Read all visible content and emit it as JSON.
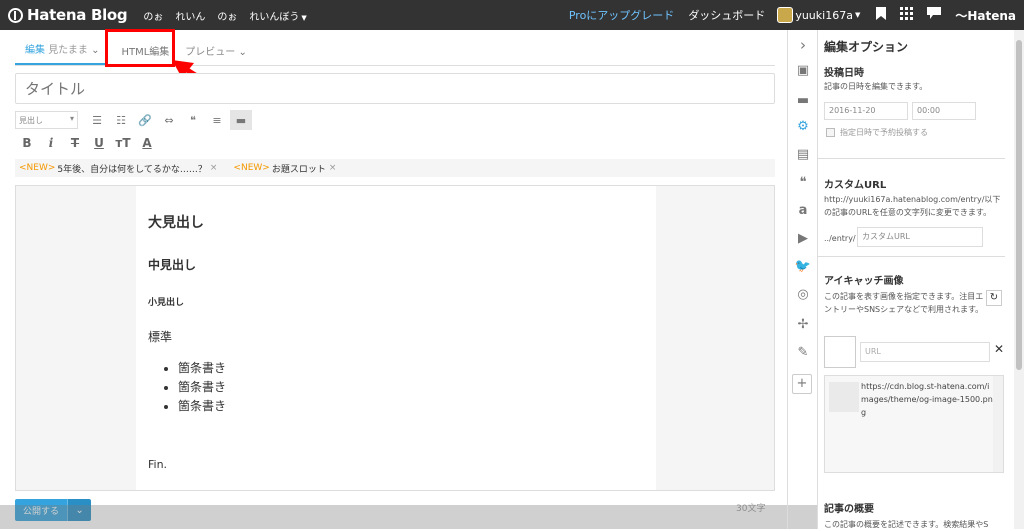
{
  "topbar": {
    "logo": "Hatena Blog",
    "nav": [
      "のぉ",
      "れいん",
      "のぉ",
      "れいんぼう"
    ],
    "pro": "Proにアップグレード",
    "dashboard": "ダッシュボード",
    "user": "yuuki167a",
    "hatena": "Hatena"
  },
  "tabs": {
    "edit": "編集",
    "edit_mode": "見たまま",
    "html": "HTML編集",
    "preview": "プレビュー"
  },
  "editor": {
    "title_placeholder": "タイトル",
    "heading_select": "見出し",
    "new_items": [
      {
        "tag": "<NEW>",
        "text": "5年後、自分は何をしてるかな……？"
      },
      {
        "tag": "<NEW>",
        "text": "お題スロット"
      }
    ],
    "content": {
      "h1": "大見出し",
      "h2": "中見出し",
      "h3": "小見出し",
      "para": "標準",
      "list": [
        "箇条書き",
        "箇条書き",
        "箇条書き"
      ],
      "fin": "Fin."
    },
    "publish": "公開する",
    "char_count": "30文字"
  },
  "panel": {
    "title": "編集オプション",
    "post_date": {
      "label": "投稿日時",
      "desc": "記事の日時を編集できます。",
      "date": "2016-11-20",
      "time": "00:00",
      "schedule": "指定日時で予約投稿する"
    },
    "custom_url": {
      "label": "カスタムURL",
      "desc": "http://yuuki167a.hatenablog.com/entry/以下の記事のURLを任意の文字列に変更できます。",
      "prefix": "../entry/",
      "placeholder": "カスタムURL"
    },
    "eyecatch": {
      "label": "アイキャッチ画像",
      "desc": "この記事を表す画像を指定できます。注目エントリーやSNSシェアなどで利用されます。",
      "url_placeholder": "URL",
      "image_url": "https://cdn.blog.st-hatena.com/images/theme/og-image-1500.png"
    },
    "summary": {
      "label": "記事の概要",
      "desc": "この記事の概要を記述できます。検索結果やS"
    }
  },
  "colors": {
    "accent": "#35a4de",
    "topbar": "#333333",
    "highlight": "#ff0000",
    "new_tag": "#f39800"
  }
}
